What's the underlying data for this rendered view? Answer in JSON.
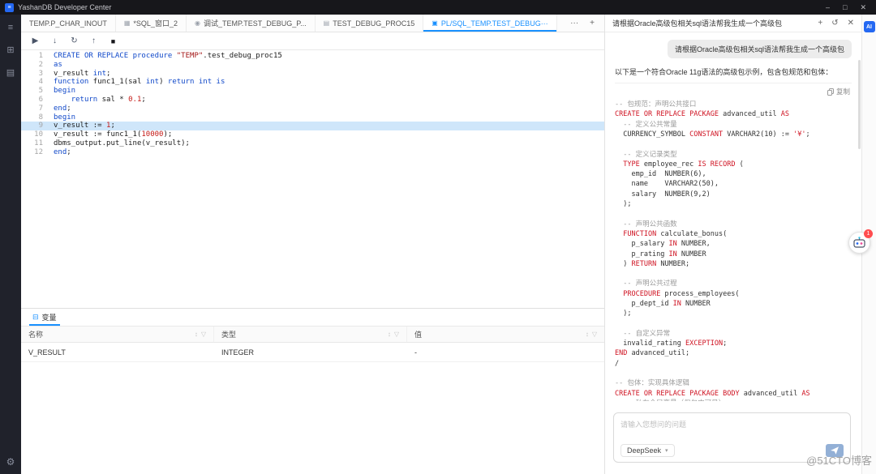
{
  "titlebar": {
    "title": "YashanDB Developer Center",
    "logo_glyph": "≡",
    "controls": [
      {
        "name": "minimize",
        "glyph": "–"
      },
      {
        "name": "maximize",
        "glyph": "□"
      },
      {
        "name": "close",
        "glyph": "✕"
      }
    ]
  },
  "rail": {
    "items": [
      {
        "name": "connections",
        "glyph": "≡"
      },
      {
        "name": "objects",
        "glyph": "⊞"
      },
      {
        "name": "files",
        "glyph": "▤"
      }
    ],
    "bottom": {
      "name": "settings",
      "glyph": "⚙"
    }
  },
  "tabs": {
    "items": [
      {
        "label": "TEMP.P_CHAR_INOUT",
        "icon": "",
        "glyph": "",
        "active": false
      },
      {
        "label": "*SQL_窗口_2",
        "icon": "sql-window",
        "glyph": "▦",
        "active": false
      },
      {
        "label": "调试_TEMP.TEST_DEBUG_P...",
        "icon": "debug",
        "glyph": "◉",
        "active": false
      },
      {
        "label": "TEST_DEBUG_PROC15",
        "icon": "document",
        "glyph": "▤",
        "active": false
      },
      {
        "label": "PL/SQL_TEMP.TEST_DEBUG···",
        "icon": "plsql-console",
        "glyph": "▣",
        "active": true
      }
    ],
    "overflow": "···",
    "add": "+"
  },
  "toolbar": {
    "buttons": [
      {
        "name": "resume",
        "glyph": "▶"
      },
      {
        "name": "step-into",
        "glyph": "↓"
      },
      {
        "name": "step-over",
        "glyph": "↻"
      },
      {
        "name": "step-out",
        "glyph": "↑"
      },
      {
        "name": "stop",
        "glyph": "■",
        "style": "stop"
      }
    ]
  },
  "editor": {
    "highlight_line": 9,
    "lines": [
      "CREATE OR REPLACE procedure \"TEMP\".test_debug_proc15",
      "as",
      "v_result int;",
      "function func1_1(sal int) return int is",
      "begin",
      "    return sal * 0.1;",
      "end;",
      "begin",
      "v_result := 1;",
      "v_result := func1_1(10000);",
      "dbms_output.put_line(v_result);",
      "end;"
    ]
  },
  "bottom_panel": {
    "tab_label": "变量",
    "tab_icon": "⊟",
    "sort_glyph": "↕",
    "filter_glyph": "▽",
    "table": {
      "columns": [
        "名称",
        "类型",
        "值"
      ],
      "rows": [
        [
          "V_RESULT",
          "INTEGER",
          "-"
        ]
      ]
    }
  },
  "chat": {
    "title": "请根据Oracle高级包相关sql语法帮我生成一个高级包",
    "header_icons": [
      {
        "name": "new-chat",
        "glyph": "+"
      },
      {
        "name": "history",
        "glyph": "↺"
      },
      {
        "name": "close",
        "glyph": "✕"
      }
    ],
    "user_message": "请根据Oracle高级包相关sql语法帮我生成一个高级包",
    "answer_intro": "以下是一个符合Oracle 11g语法的高级包示例，包含包规范和包体：",
    "copy_label": "复制",
    "code_lines": [
      "-- 包规范：声明公共接口",
      "CREATE OR REPLACE PACKAGE advanced_util AS",
      "  -- 定义公共常量",
      "  CURRENCY_SYMBOL CONSTANT VARCHAR2(10) := '¥';",
      "",
      "  -- 定义记录类型",
      "  TYPE employee_rec IS RECORD (",
      "    emp_id  NUMBER(6),",
      "    name    VARCHAR2(50),",
      "    salary  NUMBER(9,2)",
      "  );",
      "",
      "  -- 声明公共函数",
      "  FUNCTION calculate_bonus(",
      "    p_salary IN NUMBER,",
      "    p_rating IN NUMBER",
      "  ) RETURN NUMBER;",
      "",
      "  -- 声明公共过程",
      "  PROCEDURE process_employees(",
      "    p_dept_id IN NUMBER",
      "  );",
      "",
      "  -- 自定义异常",
      "  invalid_rating EXCEPTION;",
      "END advanced_util;",
      "/",
      "",
      "-- 包体：实现具体逻辑",
      "CREATE OR REPLACE PACKAGE BODY advanced_util AS",
      "  -- 私有全局变量（仅包内可见）"
    ],
    "input_placeholder": "请输入您想问的问题",
    "model": "DeepSeek"
  },
  "right_strip": {
    "ai_label": "AI"
  },
  "assistant_badge": "1",
  "watermark": "@51CTO博客",
  "colors": {
    "accent": "#1890ff",
    "logo_blue": "#2468f2",
    "editor_highlight": "#cfe6fa",
    "editor_keyword": "#1048c9",
    "chat_keyword": "#cf1322",
    "comment": "#9b9b9b",
    "badge_red": "#ff4d4f"
  }
}
